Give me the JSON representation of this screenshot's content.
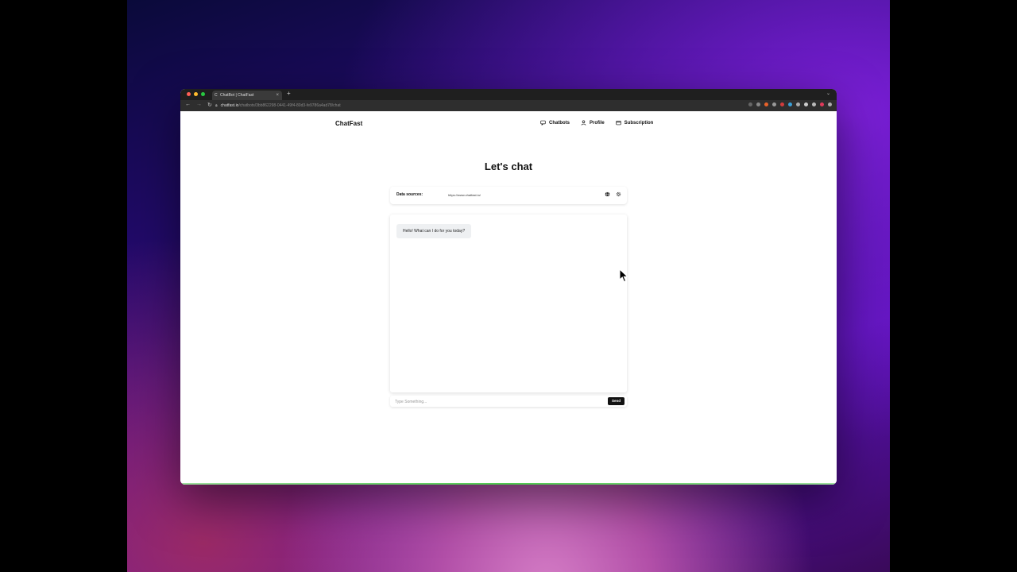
{
  "browser": {
    "tab_title": "ChatBot | ChatFast",
    "new_tab": "+",
    "tab_close": "×",
    "url_host": "chatfast.io",
    "url_path": "/chatbots/3bb862298-0441-49f4-80d3-fe9786a4ad78/chat",
    "traffic_lights": [
      "#ff5f57",
      "#febc2e",
      "#28c840"
    ]
  },
  "header": {
    "brand": "ChatFast",
    "nav": [
      {
        "label": "Chatbots",
        "icon": "chat-icon"
      },
      {
        "label": "Profile",
        "icon": "user-icon"
      },
      {
        "label": "Subscription",
        "icon": "card-icon"
      }
    ]
  },
  "main": {
    "title": "Let's chat",
    "data_sources": {
      "label": "Data sources:",
      "value": "https://www.chatfast.io/"
    },
    "messages": [
      {
        "role": "bot",
        "text": "Hello! What can I do for you today?"
      }
    ],
    "input": {
      "placeholder": "Type Something...",
      "value": ""
    },
    "send_label": "Send"
  }
}
